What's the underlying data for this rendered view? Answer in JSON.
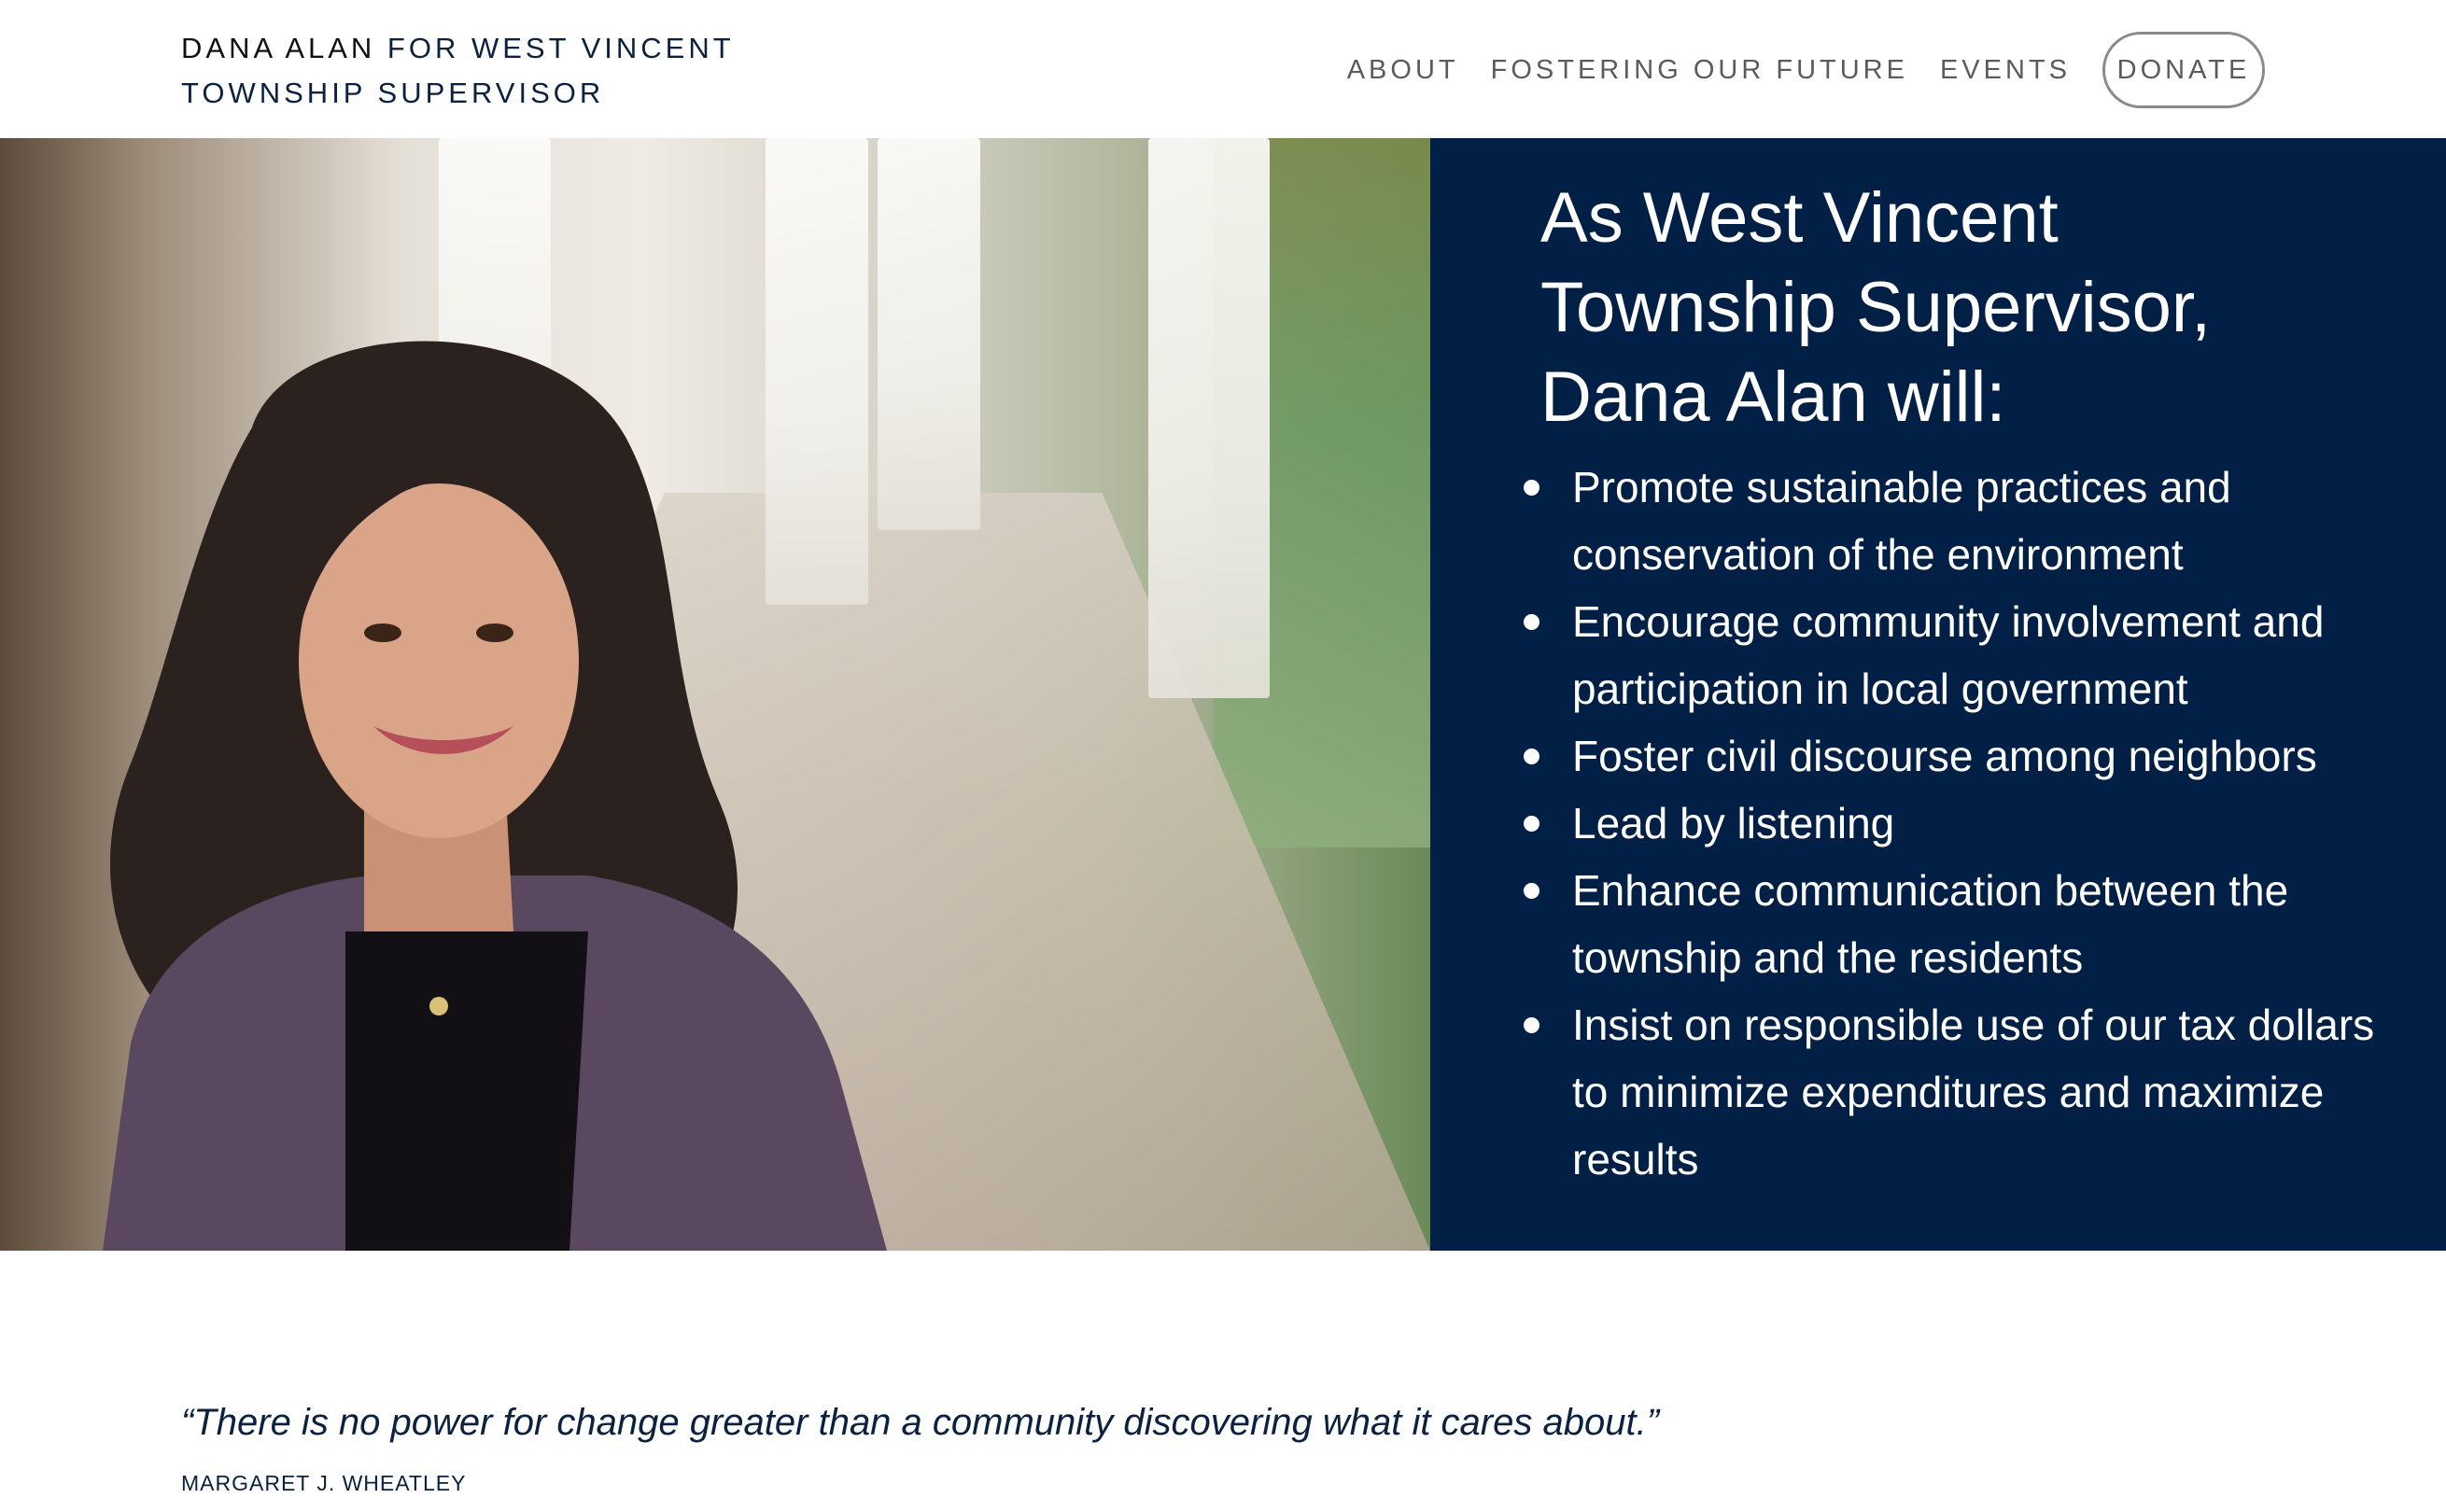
{
  "header": {
    "title_name": "DANA ALAN",
    "title_rest": " FOR WEST VINCENT TOWNSHIP SUPERVISOR",
    "nav": [
      {
        "label": "ABOUT"
      },
      {
        "label": "FOSTERING OUR FUTURE"
      },
      {
        "label": "EVENTS"
      }
    ],
    "donate_label": "DONATE"
  },
  "hero": {
    "heading": "As West Vincent Township Supervisor, Dana Alan will:",
    "items": [
      "Promote sustainable practices and conservation of the environment",
      "Encourage community involvement and participation in local government",
      "Foster civil discourse among neighbors",
      "Lead by listening",
      "Enhance communication between the township and the residents",
      "Insist on responsible use of our tax dollars to minimize expenditures and maximize results"
    ]
  },
  "quote": {
    "text": "“There is no power for change greater than a community discovering what it cares about.”",
    "attribution": "MARGARET J. WHEATLEY"
  },
  "colors": {
    "navy": "#022046",
    "nav_text": "#5b5b5b"
  }
}
